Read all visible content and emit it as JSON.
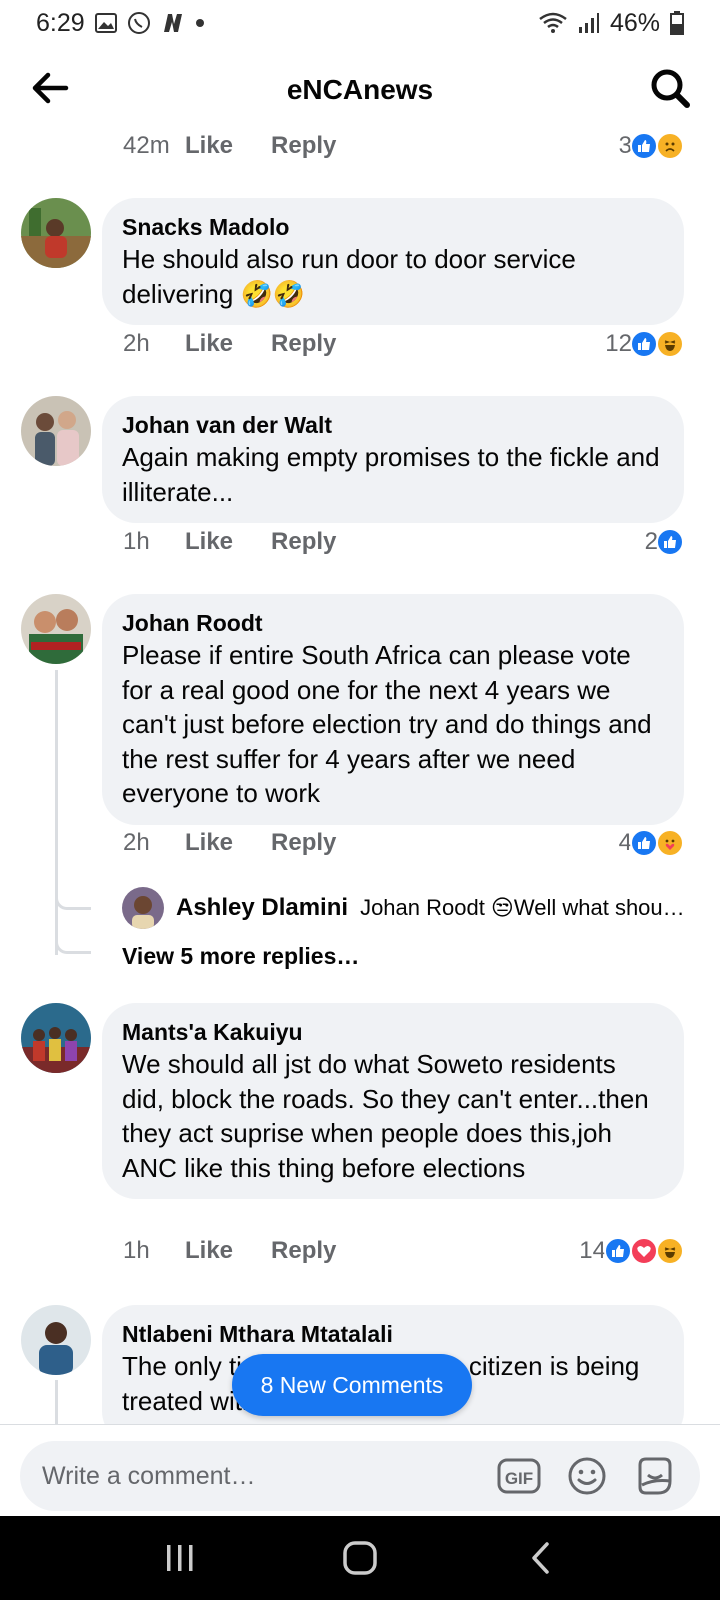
{
  "status_bar": {
    "time": "6:29",
    "battery": "46%"
  },
  "header": {
    "title": "eNCAnews"
  },
  "top_meta": {
    "time": "42m",
    "like": "Like",
    "reply": "Reply",
    "count": "3"
  },
  "comments": [
    {
      "name": "Snacks Madolo",
      "text": "He should also run door to door service delivering 🤣🤣",
      "time": "2h",
      "like": "Like",
      "reply": "Reply",
      "count": "12"
    },
    {
      "name": "Johan van der Walt",
      "text": "Again making empty promises to the fickle and illiterate...",
      "time": "1h",
      "like": "Like",
      "reply": "Reply",
      "count": "2"
    },
    {
      "name": "Johan Roodt",
      "text": "Please if entire South Africa can please vote for a real good one for the next 4 years we can't just before election try and do things and the rest suffer for 4 years after we need everyone to work",
      "time": "2h",
      "like": "Like",
      "reply": "Reply",
      "count": "4"
    },
    {
      "name": "Mants'a Kakuiyu",
      "text": "We should all jst do what Soweto residents did, block the roads. So they can't enter...then they act suprise when people does this,joh ANC like this thing before elections",
      "time": "1h",
      "like": "Like",
      "reply": "Reply",
      "count": "14"
    },
    {
      "name": "Ntlabeni Mthara Mtatalali",
      "text": "The only time a South African citizen is being treated with courtesy"
    }
  ],
  "reply_preview": {
    "name": "Ashley Dlamini",
    "text": "Johan Roodt 😒Well what shou…"
  },
  "view_more": "View 5 more replies…",
  "new_comments": "8 New Comments",
  "composer": {
    "placeholder": "Write a comment…"
  },
  "colors": {
    "brand_blue": "#1877f2",
    "bubble_bg": "#f0f2f5",
    "muted_text": "#65676b",
    "love_red": "#f33e58",
    "emoji_yellow": "#f7b125"
  }
}
